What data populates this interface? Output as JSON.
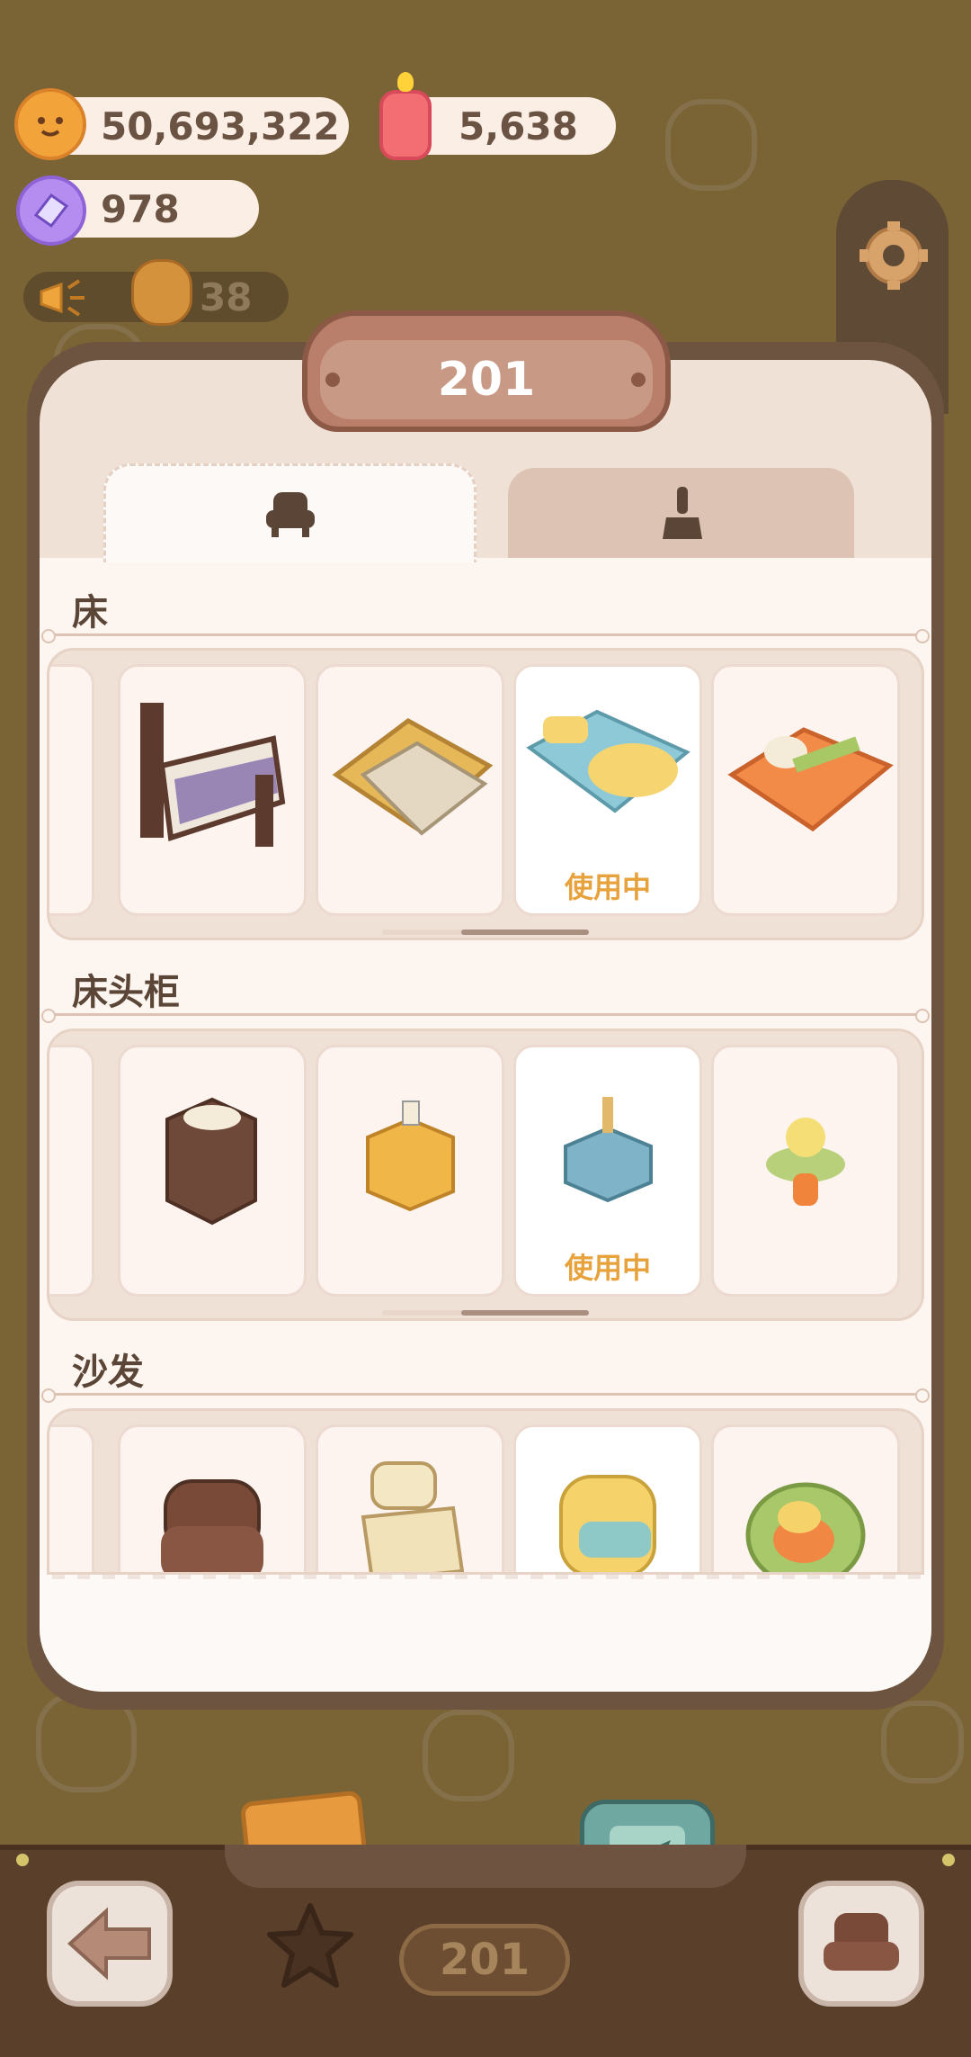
{
  "currencies": {
    "cookies": "50,693,322",
    "candles": "5,638",
    "gems": "978"
  },
  "notice": {
    "count": "38"
  },
  "room": {
    "number": "201"
  },
  "tabs": [
    {
      "id": "furniture",
      "icon": "armchair-icon",
      "active": true
    },
    {
      "id": "decor",
      "icon": "paintbrush-icon",
      "active": false
    }
  ],
  "sections": [
    {
      "title": "床",
      "in_use_label": "使用中",
      "items": [
        "bed-dark-wood",
        "bed-cream-blanket",
        "bed-blue-pillows",
        "bed-orange"
      ]
    },
    {
      "title": "床头柜",
      "in_use_label": "使用中",
      "items": [
        "nightstand-dark",
        "nightstand-yellow",
        "nightstand-blue",
        "nightstand-green-lamp"
      ]
    },
    {
      "title": "沙发",
      "items": [
        "sofa-leather",
        "sofa-cream",
        "sofa-yellow",
        "sofa-round-green"
      ]
    }
  ],
  "bottom": {
    "room_counter": "201"
  },
  "colors": {
    "accent": "#e8a23c",
    "background": "#7a6334",
    "card": "#fcf5f0",
    "frame": "#6d5440"
  }
}
